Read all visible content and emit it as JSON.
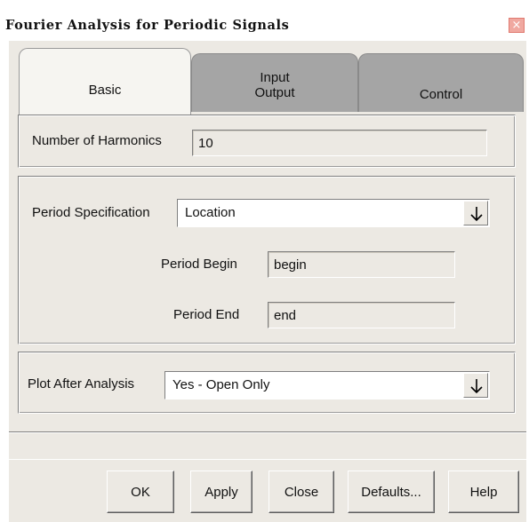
{
  "window": {
    "title": "Fourier Analysis for Periodic Signals",
    "close_glyph": "×"
  },
  "tabs": [
    {
      "label": "Basic",
      "active": true
    },
    {
      "label_line1": "Input",
      "label_line2": "Output",
      "active": false
    },
    {
      "label": "Control",
      "active": false
    }
  ],
  "harmonics": {
    "label": "Number of Harmonics",
    "value": "10"
  },
  "period": {
    "spec_label": "Period Specification",
    "spec_value": "Location",
    "begin_label": "Period Begin",
    "begin_value": "begin",
    "end_label": "Period End",
    "end_value": "end"
  },
  "plot": {
    "label": "Plot After Analysis",
    "value": "Yes - Open Only"
  },
  "buttons": {
    "ok": "OK",
    "apply": "Apply",
    "close": "Close",
    "defaults": "Defaults...",
    "help": "Help"
  },
  "colors": {
    "dialog_bg": "#ece9e3",
    "inactive_tab": "#a5a5a5",
    "close_button": "#f0a8a0"
  },
  "icons": {
    "close": "close-icon",
    "dropdown": "arrow-down-icon"
  }
}
